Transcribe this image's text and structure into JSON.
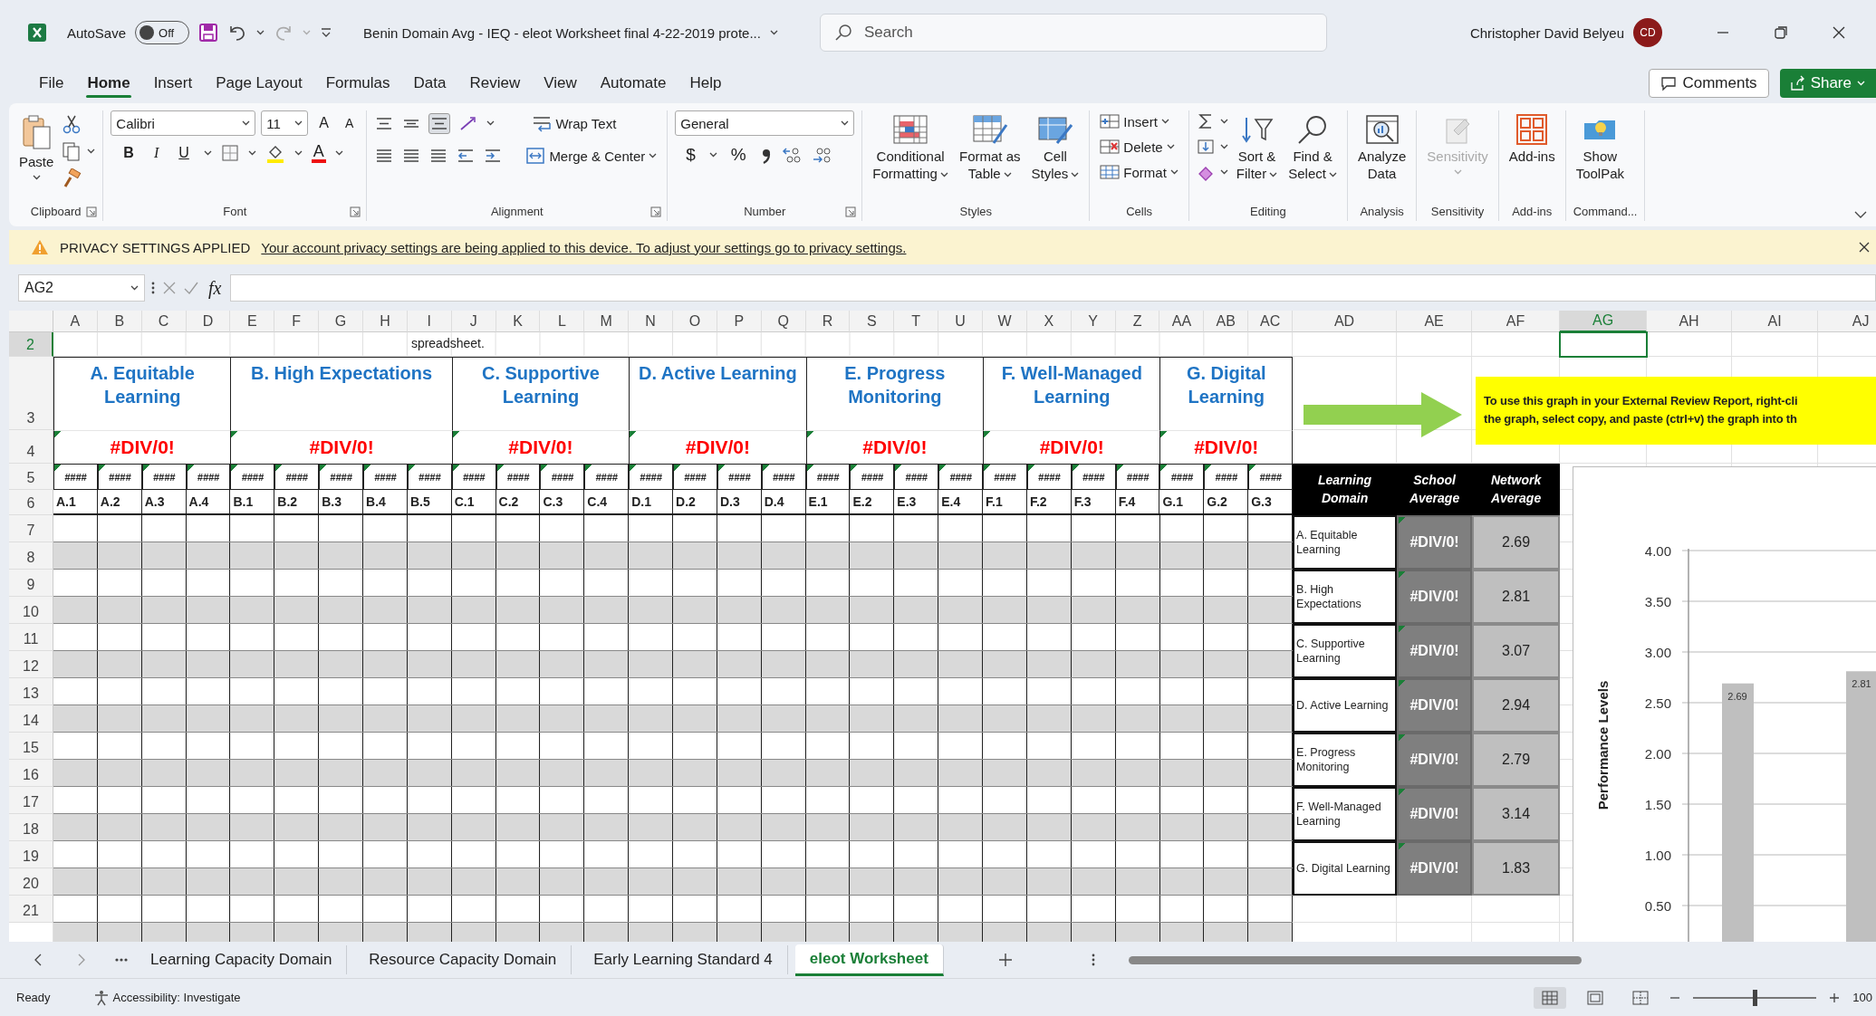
{
  "title_bar": {
    "autosave_label": "AutoSave",
    "autosave": {
      "label": "Off",
      "on": false
    },
    "document_title": "Benin Domain Avg - IEQ - eleot Worksheet final 4-22-2019 prote...",
    "search": {
      "placeholder": "Search"
    },
    "user_name": "Christopher David Belyeu",
    "avatar_initials": "CD"
  },
  "menu_tabs": [
    {
      "label": "File",
      "selected": false
    },
    {
      "label": "Home",
      "selected": true
    },
    {
      "label": "Insert",
      "selected": false
    },
    {
      "label": "Page Layout",
      "selected": false
    },
    {
      "label": "Formulas",
      "selected": false
    },
    {
      "label": "Data",
      "selected": false
    },
    {
      "label": "Review",
      "selected": false
    },
    {
      "label": "View",
      "selected": false
    },
    {
      "label": "Automate",
      "selected": false
    },
    {
      "label": "Help",
      "selected": false
    }
  ],
  "comments_button": "Comments",
  "share_button": "Share",
  "ribbon": {
    "groups": [
      {
        "kind": "clipboard",
        "label": "Clipboard",
        "launcher": true,
        "paste": "Paste"
      },
      {
        "kind": "font",
        "label": "Font",
        "launcher": true,
        "font_name": "Calibri",
        "font_size": "11",
        "grow": "A",
        "shrink": "A",
        "bold": "B",
        "italic": "I",
        "underline": "U",
        "font_color": "A"
      },
      {
        "kind": "alignment",
        "label": "Alignment",
        "launcher": true,
        "vertical_align": [
          {
            "selected": false
          },
          {
            "selected": false
          },
          {
            "selected": true
          }
        ],
        "wrap_text": "Wrap Text",
        "merge_center": "Merge & Center"
      },
      {
        "kind": "number",
        "label": "Number",
        "launcher": true,
        "format": "General",
        "currency": "$",
        "percent": "%"
      },
      {
        "kind": "styles",
        "label": "Styles",
        "launcher": false,
        "buttons": [
          {
            "label": "Conditional Formatting",
            "dropdown": true,
            "disabled": false
          },
          {
            "label": "Format as Table",
            "dropdown": true,
            "disabled": false
          },
          {
            "label": "Cell Styles",
            "dropdown": true,
            "disabled": false
          }
        ]
      },
      {
        "kind": "cells",
        "label": "Cells",
        "launcher": false,
        "items": [
          {
            "label": "Insert"
          },
          {
            "label": "Delete"
          },
          {
            "label": "Format"
          }
        ]
      },
      {
        "kind": "editing",
        "label": "Editing",
        "launcher": false,
        "buttons": [
          {
            "label": "Sort & Filter",
            "dropdown": true,
            "disabled": false
          },
          {
            "label": "Find & Select",
            "dropdown": true,
            "disabled": false
          }
        ]
      },
      {
        "kind": "analysis",
        "label": "Analysis",
        "launcher": false,
        "buttons": [
          {
            "label": "Analyze Data",
            "dropdown": false,
            "disabled": false
          }
        ]
      },
      {
        "kind": "sensitivity",
        "label": "Sensitivity",
        "launcher": false,
        "buttons": [
          {
            "label": "Sensitivity",
            "dropdown": true,
            "disabled": true
          }
        ]
      },
      {
        "kind": "addins",
        "label": "Add-ins",
        "launcher": false,
        "buttons": [
          {
            "label": "Add-ins",
            "dropdown": false,
            "disabled": false
          }
        ]
      },
      {
        "kind": "command",
        "label": "Command...",
        "launcher": false,
        "buttons": [
          {
            "label": "Show ToolPak",
            "dropdown": false,
            "disabled": false
          }
        ]
      }
    ]
  },
  "privacy_bar": {
    "title": "PRIVACY SETTINGS APPLIED",
    "message": "Your account privacy settings are being applied to this device. To adjust your settings go to privacy settings."
  },
  "formula_bar": {
    "name_box": "AG2",
    "fx": "fx"
  },
  "sheet": {
    "columns": [
      {
        "label": "A",
        "selected": false
      },
      {
        "label": "B",
        "selected": false
      },
      {
        "label": "C",
        "selected": false
      },
      {
        "label": "D",
        "selected": false
      },
      {
        "label": "E",
        "selected": false
      },
      {
        "label": "F",
        "selected": false
      },
      {
        "label": "G",
        "selected": false
      },
      {
        "label": "H",
        "selected": false
      },
      {
        "label": "I",
        "selected": false
      },
      {
        "label": "J",
        "selected": false
      },
      {
        "label": "K",
        "selected": false
      },
      {
        "label": "L",
        "selected": false
      },
      {
        "label": "M",
        "selected": false
      },
      {
        "label": "N",
        "selected": false
      },
      {
        "label": "O",
        "selected": false
      },
      {
        "label": "P",
        "selected": false
      },
      {
        "label": "Q",
        "selected": false
      },
      {
        "label": "R",
        "selected": false
      },
      {
        "label": "S",
        "selected": false
      },
      {
        "label": "T",
        "selected": false
      },
      {
        "label": "U",
        "selected": false
      },
      {
        "label": "W",
        "selected": false
      },
      {
        "label": "X",
        "selected": false
      },
      {
        "label": "Y",
        "selected": false
      },
      {
        "label": "Z",
        "selected": false
      },
      {
        "label": "AA",
        "selected": false
      },
      {
        "label": "AB",
        "selected": false
      },
      {
        "label": "AC",
        "selected": false
      },
      {
        "label": "AD",
        "selected": false
      },
      {
        "label": "AE",
        "selected": false
      },
      {
        "label": "AF",
        "selected": false
      },
      {
        "label": "AG",
        "selected": true
      },
      {
        "label": "AH",
        "selected": false
      },
      {
        "label": "AI",
        "selected": false
      },
      {
        "label": "AJ",
        "selected": false
      }
    ],
    "rows": [
      {
        "label": "2",
        "selected": true
      },
      {
        "label": "3",
        "selected": false
      },
      {
        "label": "4",
        "selected": false
      },
      {
        "label": "5",
        "selected": false
      },
      {
        "label": "6",
        "selected": false
      },
      {
        "label": "7",
        "selected": false
      },
      {
        "label": "8",
        "selected": false
      },
      {
        "label": "9",
        "selected": false
      },
      {
        "label": "10",
        "selected": false
      },
      {
        "label": "11",
        "selected": false
      },
      {
        "label": "12",
        "selected": false
      },
      {
        "label": "13",
        "selected": false
      },
      {
        "label": "14",
        "selected": false
      },
      {
        "label": "15",
        "selected": false
      },
      {
        "label": "16",
        "selected": false
      },
      {
        "label": "17",
        "selected": false
      },
      {
        "label": "18",
        "selected": false
      },
      {
        "label": "19",
        "selected": false
      },
      {
        "label": "20",
        "selected": false
      },
      {
        "label": "21",
        "selected": false
      }
    ],
    "note_cell": "spreadsheet.",
    "domains": [
      {
        "title": "A. Equitable Learning",
        "result": "#DIV/0!",
        "indicators": [
          {
            "value": "####",
            "code": "A.1"
          },
          {
            "value": "####",
            "code": "A.2"
          },
          {
            "value": "####",
            "code": "A.3"
          },
          {
            "value": "####",
            "code": "A.4"
          }
        ]
      },
      {
        "title": "B. High Expectations",
        "result": "#DIV/0!",
        "indicators": [
          {
            "value": "####",
            "code": "B.1"
          },
          {
            "value": "####",
            "code": "B.2"
          },
          {
            "value": "####",
            "code": "B.3"
          },
          {
            "value": "####",
            "code": "B.4"
          },
          {
            "value": "####",
            "code": "B.5"
          }
        ]
      },
      {
        "title": "C. Supportive Learning",
        "result": "#DIV/0!",
        "indicators": [
          {
            "value": "####",
            "code": "C.1"
          },
          {
            "value": "####",
            "code": "C.2"
          },
          {
            "value": "####",
            "code": "C.3"
          },
          {
            "value": "####",
            "code": "C.4"
          }
        ]
      },
      {
        "title": "D. Active Learning",
        "result": "#DIV/0!",
        "indicators": [
          {
            "value": "####",
            "code": "D.1"
          },
          {
            "value": "####",
            "code": "D.2"
          },
          {
            "value": "####",
            "code": "D.3"
          },
          {
            "value": "####",
            "code": "D.4"
          }
        ]
      },
      {
        "title": "E. Progress Monitoring",
        "result": "#DIV/0!",
        "indicators": [
          {
            "value": "####",
            "code": "E.1"
          },
          {
            "value": "####",
            "code": "E.2"
          },
          {
            "value": "####",
            "code": "E.3"
          },
          {
            "value": "####",
            "code": "E.4"
          }
        ]
      },
      {
        "title": "F. Well-Managed Learning",
        "result": "#DIV/0!",
        "indicators": [
          {
            "value": "####",
            "code": "F.1"
          },
          {
            "value": "####",
            "code": "F.2"
          },
          {
            "value": "####",
            "code": "F.3"
          },
          {
            "value": "####",
            "code": "F.4"
          }
        ]
      },
      {
        "title": "G. Digital Learning",
        "result": "#DIV/0!",
        "indicators": [
          {
            "value": "####",
            "code": "G.1"
          },
          {
            "value": "####",
            "code": "G.2"
          },
          {
            "value": "####",
            "code": "G.3"
          }
        ]
      }
    ],
    "instruction_note": {
      "lines": [
        "To use this graph in your External Review Report, right-cli",
        "the graph, select copy, and paste (ctrl+v) the graph into th"
      ]
    },
    "summary_table": {
      "headers": [
        "Learning Domain",
        "School Average",
        "Network Average"
      ],
      "rows": [
        {
          "domain": "A. Equitable Learning",
          "school": "#DIV/0!",
          "network": "2.69"
        },
        {
          "domain": "B. High Expectations",
          "school": "#DIV/0!",
          "network": "2.81"
        },
        {
          "domain": "C. Supportive Learning",
          "school": "#DIV/0!",
          "network": "3.07"
        },
        {
          "domain": "D. Active Learning",
          "school": "#DIV/0!",
          "network": "2.94"
        },
        {
          "domain": "E. Progress Monitoring",
          "school": "#DIV/0!",
          "network": "2.79"
        },
        {
          "domain": "F. Well-Managed Learning",
          "school": "#DIV/0!",
          "network": "3.14"
        },
        {
          "domain": "G. Digital Learning",
          "school": "#DIV/0!",
          "network": "1.83"
        }
      ]
    },
    "chart": {
      "chart_data": {
        "type": "bar",
        "ylabel": "Performance Levels",
        "ylim": [
          0,
          4
        ],
        "grid": true,
        "yticks": [
          {
            "value": 0.5,
            "label": "0.50"
          },
          {
            "value": 1,
            "label": "1.00"
          },
          {
            "value": 1.5,
            "label": "1.50"
          },
          {
            "value": 2,
            "label": "2.00"
          },
          {
            "value": 2.5,
            "label": "2.50"
          },
          {
            "value": 3,
            "label": "3.00"
          },
          {
            "value": 3.5,
            "label": "3.50"
          },
          {
            "value": 4,
            "label": "4.00"
          }
        ],
        "series": [
          {
            "color": "#bfbfbf",
            "values": [
              2.69,
              2.81
            ]
          }
        ],
        "data_labels": true
      }
    }
  },
  "sheet_tabs": [
    {
      "label": "Learning Capacity Domain",
      "selected": false
    },
    {
      "label": "Resource Capacity Domain",
      "selected": false
    },
    {
      "label": "Early Learning Standard 4",
      "selected": false
    },
    {
      "label": "eleot Worksheet",
      "selected": true
    }
  ],
  "status_bar": {
    "status": "Ready",
    "accessibility": "Accessibility: Investigate",
    "views": [
      {
        "kind": "normal",
        "selected": true
      },
      {
        "kind": "page_layout",
        "selected": false
      },
      {
        "kind": "page_break",
        "selected": false
      }
    ],
    "zoom": {
      "level": 0.5,
      "label": "100"
    }
  }
}
